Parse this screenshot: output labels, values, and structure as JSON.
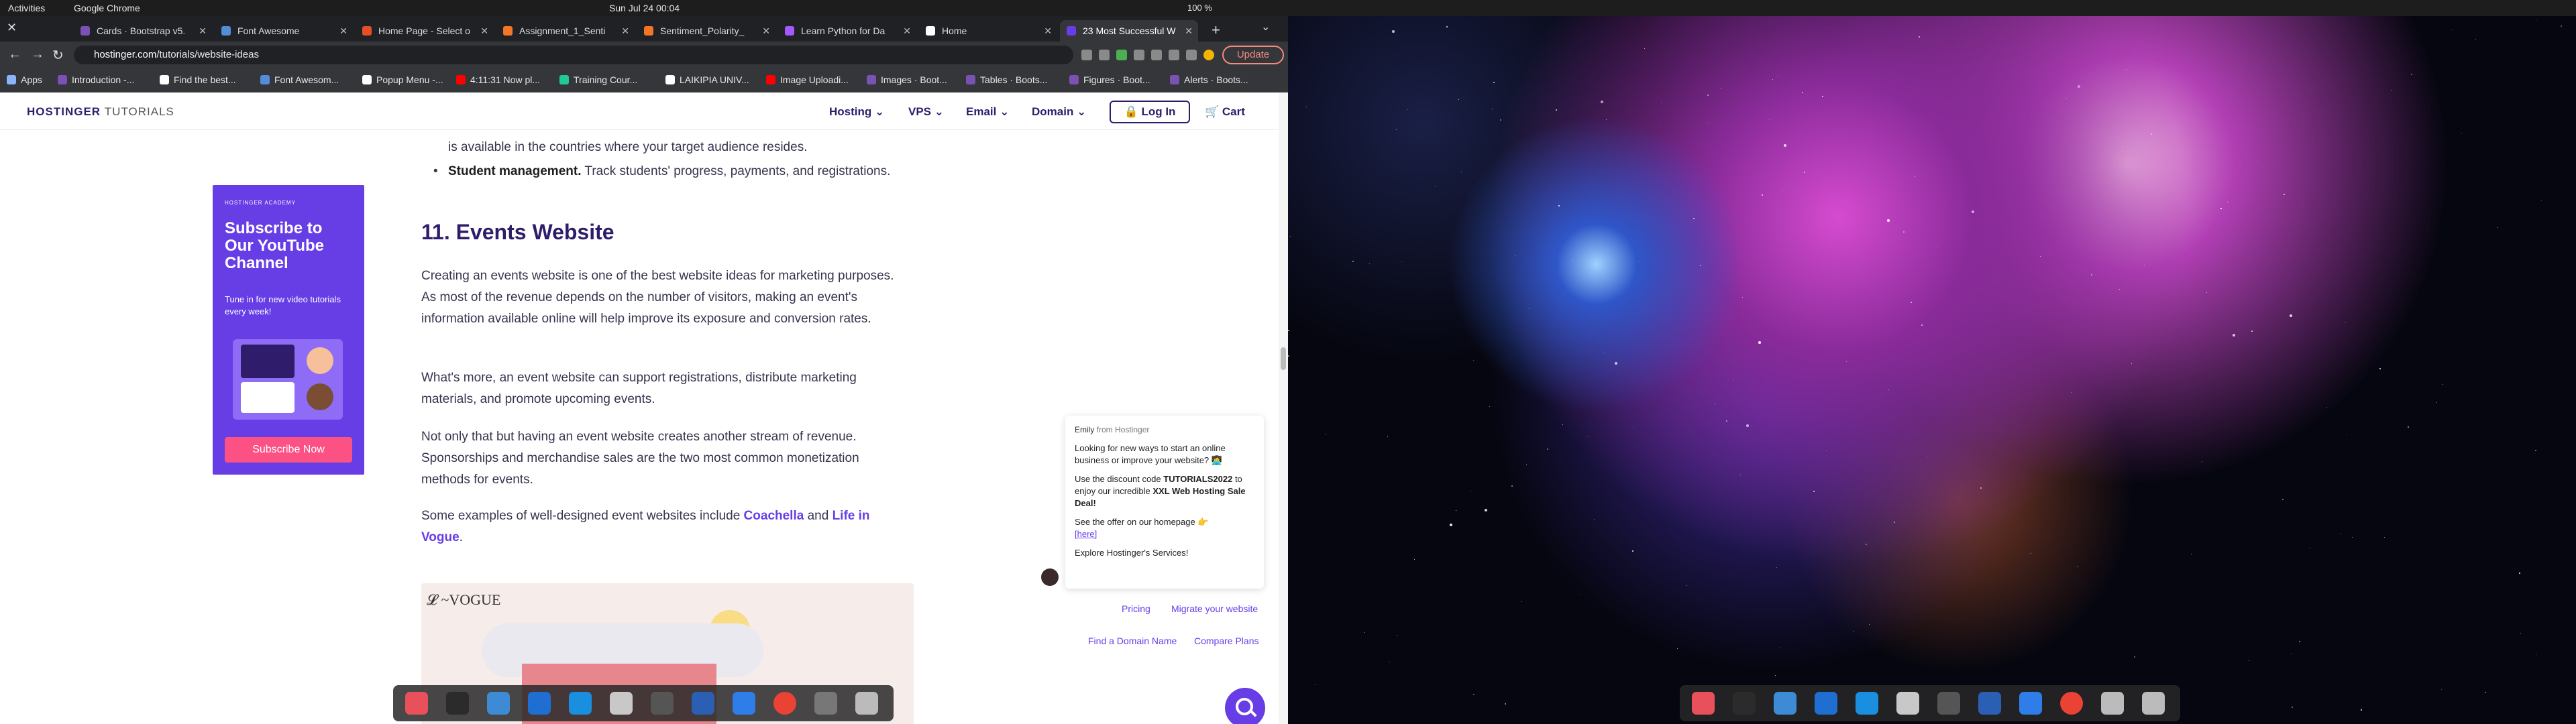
{
  "system": {
    "activities": "Activities",
    "app_name": "Google Chrome",
    "clock": "Sun Jul 24  00:04",
    "battery": "100 %"
  },
  "browser": {
    "tabs": [
      {
        "label": "Cards · Bootstrap v5.",
        "color": "#7952b3"
      },
      {
        "label": "Font Awesome",
        "color": "#528dd7"
      },
      {
        "label": "Home Page - Select o",
        "color": "#e34f26"
      },
      {
        "label": "Assignment_1_Senti",
        "color": "#f37626"
      },
      {
        "label": "Sentiment_Polarity_",
        "color": "#f37626"
      },
      {
        "label": "Learn Python for Da",
        "color": "#a259ff"
      },
      {
        "label": "Home",
        "color": "#ffffff"
      },
      {
        "label": "23 Most Successful W",
        "color": "#673de6"
      }
    ],
    "url_host": "hostinger.com",
    "url_path": "/tutorials/website-ideas",
    "update_label": "Update",
    "bookmarks": [
      {
        "label": "Apps",
        "color": "#8ab4f8"
      },
      {
        "label": "Introduction -...",
        "color": "#7952b3"
      },
      {
        "label": "Find the best...",
        "color": "#ffffff"
      },
      {
        "label": "Font Awesom...",
        "color": "#528dd7"
      },
      {
        "label": "Popup Menu -...",
        "color": "#ffffff"
      },
      {
        "label": "4:11:31 Now pl...",
        "color": "#ff0000"
      },
      {
        "label": "Training Cour...",
        "color": "#20c997"
      },
      {
        "label": "LAIKIPIA UNIV...",
        "color": "#ffffff"
      },
      {
        "label": "Image Uploadi...",
        "color": "#ff0000"
      },
      {
        "label": "Images · Boot...",
        "color": "#7952b3"
      },
      {
        "label": "Tables · Boots...",
        "color": "#7952b3"
      },
      {
        "label": "Figures · Boot...",
        "color": "#7952b3"
      },
      {
        "label": "Alerts · Boots...",
        "color": "#7952b3"
      }
    ]
  },
  "site": {
    "logo": "HOSTINGER",
    "logo_sub": "TUTORIALS",
    "nav": [
      "Hosting",
      "VPS",
      "Email",
      "Domain"
    ],
    "login": "Log In",
    "cart": "Cart",
    "promo": {
      "academy": "HOSTINGER ACADEMY",
      "title": "Subscribe to Our YouTube Channel",
      "text": "Tune in for new video tutorials every week!",
      "button": "Subscribe Now"
    },
    "article": {
      "prev_line": "is available in the countries where your target audience resides.",
      "bullet_bold": "Student management.",
      "bullet_text": " Track students' progress, payments, and registrations.",
      "heading": "11. Events Website",
      "p1": "Creating an events website is one of the best website ideas for marketing purposes. As most of the revenue depends on the number of visitors, making an event's information available online will help improve its exposure and conversion rates.",
      "p2": "What's more, an event website can support registrations, distribute marketing materials, and promote upcoming events.",
      "p3": "Not only that but having an event website creates another stream of revenue. Sponsorships and merchandise sales are the two most common monetization methods for events.",
      "p4_prefix": "Some examples of well-designed event websites include ",
      "link1": "Coachella",
      "and": " and ",
      "link2": "Life in Vogue",
      "p4_suffix": ".",
      "hero_brand": "Life in VOGUE"
    },
    "chat": {
      "agent": "Emily",
      "from": " from Hostinger",
      "m1": "Looking for new ways to start an online business or improve your website? 👩‍💻",
      "m2_prefix": "Use the discount code ",
      "code": "TUTORIALS2022",
      "m2_mid": " to enjoy our incredible ",
      "deal": "XXL Web Hosting Sale Deal!",
      "m3": "See the offer on our homepage 👉",
      "here": "[here]",
      "m4": "Explore Hostinger's Services!"
    },
    "quick_links": [
      "Pricing",
      "Migrate your website",
      "Find a Domain Name",
      "Compare Plans"
    ]
  },
  "dock_left": [
    "#e8505b",
    "#2b2b2b",
    "#3d8bd4",
    "#1f6fd2",
    "#1a8fe0",
    "#c8c8c8",
    "#555555",
    "#2b5fb3",
    "#2e7de9",
    "#ea4335",
    "#777777",
    "#bbbbbb"
  ],
  "dock_right": [
    "#e8505b",
    "#2b2b2b",
    "#3d8bd4",
    "#1f6fd2",
    "#1a8fe0",
    "#c8c8c8",
    "#555555",
    "#2b5fb3",
    "#2e7de9",
    "#ea4335",
    "#bbbbbb",
    "#bbbbbb"
  ]
}
